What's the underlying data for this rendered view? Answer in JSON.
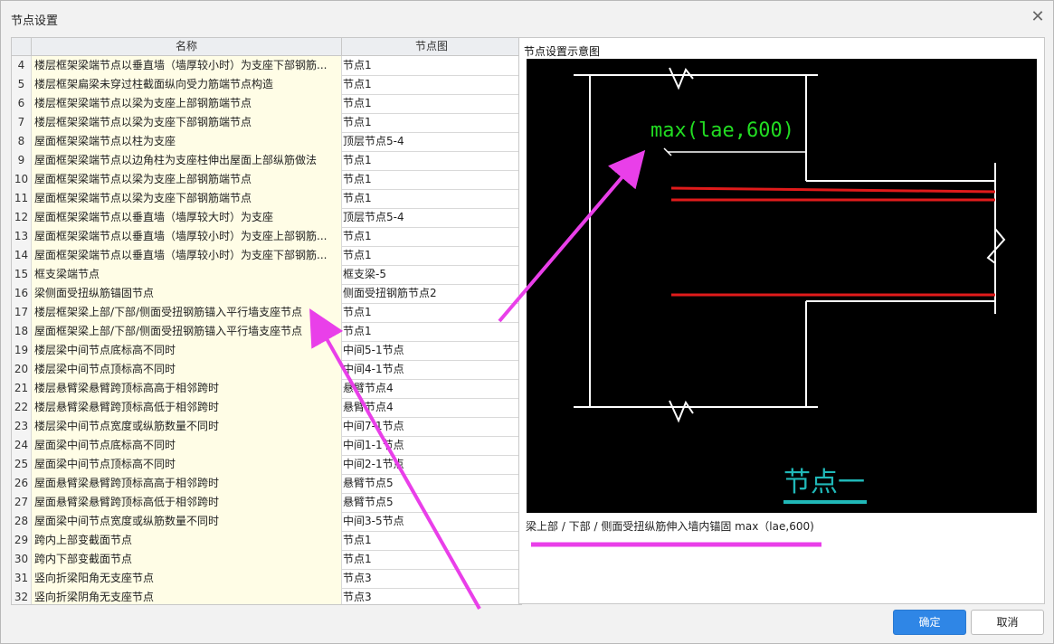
{
  "dialog": {
    "title": "节点设置",
    "close_glyph": "✕"
  },
  "table": {
    "columns": [
      "名称",
      "节点图"
    ],
    "rows": [
      {
        "idx": "4",
        "name": "楼层框架梁端节点以垂直墙（墙厚较小时）为支座下部钢筋...",
        "node": "节点1"
      },
      {
        "idx": "5",
        "name": "楼层框架扁梁未穿过柱截面纵向受力筋端节点构造",
        "node": "节点1"
      },
      {
        "idx": "6",
        "name": "楼层框架梁端节点以梁为支座上部钢筋端节点",
        "node": "节点1"
      },
      {
        "idx": "7",
        "name": "楼层框架梁端节点以梁为支座下部钢筋端节点",
        "node": "节点1"
      },
      {
        "idx": "8",
        "name": "屋面框架梁端节点以柱为支座",
        "node": "顶层节点5-4"
      },
      {
        "idx": "9",
        "name": "屋面框架梁端节点以边角柱为支座柱伸出屋面上部纵筋做法",
        "node": "节点1"
      },
      {
        "idx": "10",
        "name": "屋面框架梁端节点以梁为支座上部钢筋端节点",
        "node": "节点1"
      },
      {
        "idx": "11",
        "name": "屋面框架梁端节点以梁为支座下部钢筋端节点",
        "node": "节点1"
      },
      {
        "idx": "12",
        "name": "屋面框架梁端节点以垂直墙（墙厚较大时）为支座",
        "node": "顶层节点5-4"
      },
      {
        "idx": "13",
        "name": "屋面框架梁端节点以垂直墙（墙厚较小时）为支座上部钢筋...",
        "node": "节点1"
      },
      {
        "idx": "14",
        "name": "屋面框架梁端节点以垂直墙（墙厚较小时）为支座下部钢筋...",
        "node": "节点1"
      },
      {
        "idx": "15",
        "name": "框支梁端节点",
        "node": "框支梁-5"
      },
      {
        "idx": "16",
        "name": "梁侧面受扭纵筋锚固节点",
        "node": "侧面受扭钢筋节点2"
      },
      {
        "idx": "17",
        "name": "楼层框架梁上部/下部/侧面受扭钢筋锚入平行墙支座节点",
        "node": "节点1"
      },
      {
        "idx": "18",
        "name": "屋面框架梁上部/下部/侧面受扭钢筋锚入平行墙支座节点",
        "node": "节点1"
      },
      {
        "idx": "19",
        "name": "楼层梁中间节点底标高不同时",
        "node": "中间5-1节点"
      },
      {
        "idx": "20",
        "name": "楼层梁中间节点顶标高不同时",
        "node": "中间4-1节点"
      },
      {
        "idx": "21",
        "name": "楼层悬臂梁悬臂跨顶标高高于相邻跨时",
        "node": "悬臂节点4"
      },
      {
        "idx": "22",
        "name": "楼层悬臂梁悬臂跨顶标高低于相邻跨时",
        "node": "悬臂节点4"
      },
      {
        "idx": "23",
        "name": "楼层梁中间节点宽度或纵筋数量不同时",
        "node": "中间7-1节点"
      },
      {
        "idx": "24",
        "name": "屋面梁中间节点底标高不同时",
        "node": "中间1-1节点"
      },
      {
        "idx": "25",
        "name": "屋面梁中间节点顶标高不同时",
        "node": "中间2-1节点"
      },
      {
        "idx": "26",
        "name": "屋面悬臂梁悬臂跨顶标高高于相邻跨时",
        "node": "悬臂节点5"
      },
      {
        "idx": "27",
        "name": "屋面悬臂梁悬臂跨顶标高低于相邻跨时",
        "node": "悬臂节点5"
      },
      {
        "idx": "28",
        "name": "屋面梁中间节点宽度或纵筋数量不同时",
        "node": "中间3-5节点"
      },
      {
        "idx": "29",
        "name": "跨内上部变截面节点",
        "node": "节点1"
      },
      {
        "idx": "30",
        "name": "跨内下部变截面节点",
        "node": "节点1"
      },
      {
        "idx": "31",
        "name": "竖向折梁阳角无支座节点",
        "node": "节点3"
      },
      {
        "idx": "32",
        "name": "竖向折梁阴角无支座节点",
        "node": "节点3"
      }
    ]
  },
  "preview": {
    "label": "节点设置示意图",
    "formula": "max(lae,600)",
    "node_title": "节点一",
    "caption": "梁上部 / 下部 / 侧面受扭纵筋伸入墙内锚固 max（lae,600)"
  },
  "buttons": {
    "ok": "确定",
    "cancel": "取消"
  },
  "colors": {
    "primary": "#2f86e6",
    "annotation": "#e93fe9",
    "formula": "#22dd22",
    "rebar": "#e01b1b",
    "node_title": "#20b8b8"
  }
}
